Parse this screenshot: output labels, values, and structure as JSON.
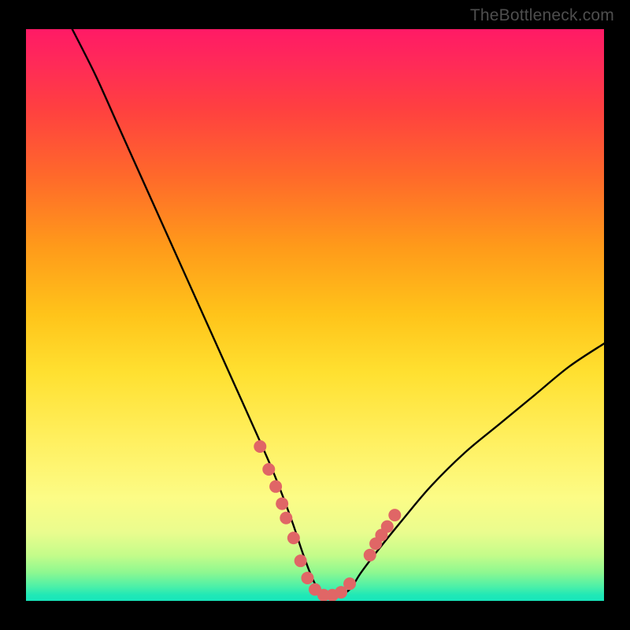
{
  "watermark": "TheBottleneck.com",
  "colors": {
    "background": "#000000",
    "curve_stroke": "#000000",
    "marker_fill": "#e06666",
    "marker_stroke": "#d85a5a"
  },
  "chart_data": {
    "type": "line",
    "title": "",
    "xlabel": "",
    "ylabel": "",
    "xlim": [
      0,
      100
    ],
    "ylim": [
      0,
      100
    ],
    "grid": false,
    "legend": false,
    "description": "V-shaped bottleneck curve: value falls from ~100 at x≈8 to ~0 in a flat trough near x≈48–56, then rises to ~45 at x=100. Pink markers cluster on the curve near the bottom of the V.",
    "series": [
      {
        "name": "bottleneck-curve",
        "x": [
          8,
          12,
          16,
          20,
          24,
          28,
          32,
          36,
          40,
          43,
          46,
          48,
          50,
          52,
          54,
          56,
          58,
          61,
          65,
          70,
          76,
          82,
          88,
          94,
          100
        ],
        "y": [
          100,
          92,
          83,
          74,
          65,
          56,
          47,
          38,
          29,
          22,
          14,
          8,
          3,
          1,
          1,
          2,
          5,
          9,
          14,
          20,
          26,
          31,
          36,
          41,
          45
        ]
      }
    ],
    "markers": [
      {
        "x": 40.5,
        "y": 27
      },
      {
        "x": 42.0,
        "y": 23
      },
      {
        "x": 43.2,
        "y": 20
      },
      {
        "x": 44.3,
        "y": 17
      },
      {
        "x": 45.0,
        "y": 14.5
      },
      {
        "x": 46.3,
        "y": 11
      },
      {
        "x": 47.5,
        "y": 7
      },
      {
        "x": 48.7,
        "y": 4
      },
      {
        "x": 50.0,
        "y": 2
      },
      {
        "x": 51.5,
        "y": 1
      },
      {
        "x": 53.0,
        "y": 1
      },
      {
        "x": 54.5,
        "y": 1.5
      },
      {
        "x": 56.0,
        "y": 3
      },
      {
        "x": 59.5,
        "y": 8
      },
      {
        "x": 60.5,
        "y": 10
      },
      {
        "x": 61.5,
        "y": 11.5
      },
      {
        "x": 62.5,
        "y": 13
      },
      {
        "x": 63.8,
        "y": 15
      }
    ]
  }
}
